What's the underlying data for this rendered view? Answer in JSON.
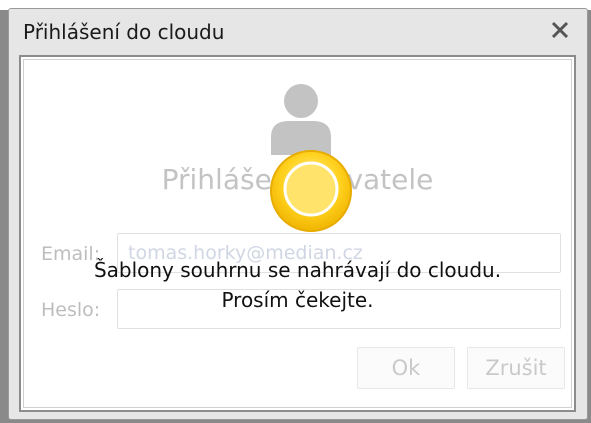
{
  "dialog": {
    "title": "Přihlášení do cloudu",
    "close_icon": "close-icon"
  },
  "login": {
    "user_icon": "user-icon",
    "heading": "Přihlášení uživatele",
    "email_label": "Email:",
    "email_value": "tomas.horky@median.cz",
    "password_label": "Heslo:",
    "password_value": "",
    "ok_label": "Ok",
    "cancel_label": "Zrušit"
  },
  "overlay": {
    "spinner_icon": "loading-spinner-icon",
    "message_line1": "Šablony souhrnu se nahrávají do cloudu.",
    "message_line2": "Prosím čekejte."
  },
  "colors": {
    "spinner": "#ffd21f",
    "panel_border": "#8c8c8c",
    "dialog_bg": "#e6e6e6"
  }
}
